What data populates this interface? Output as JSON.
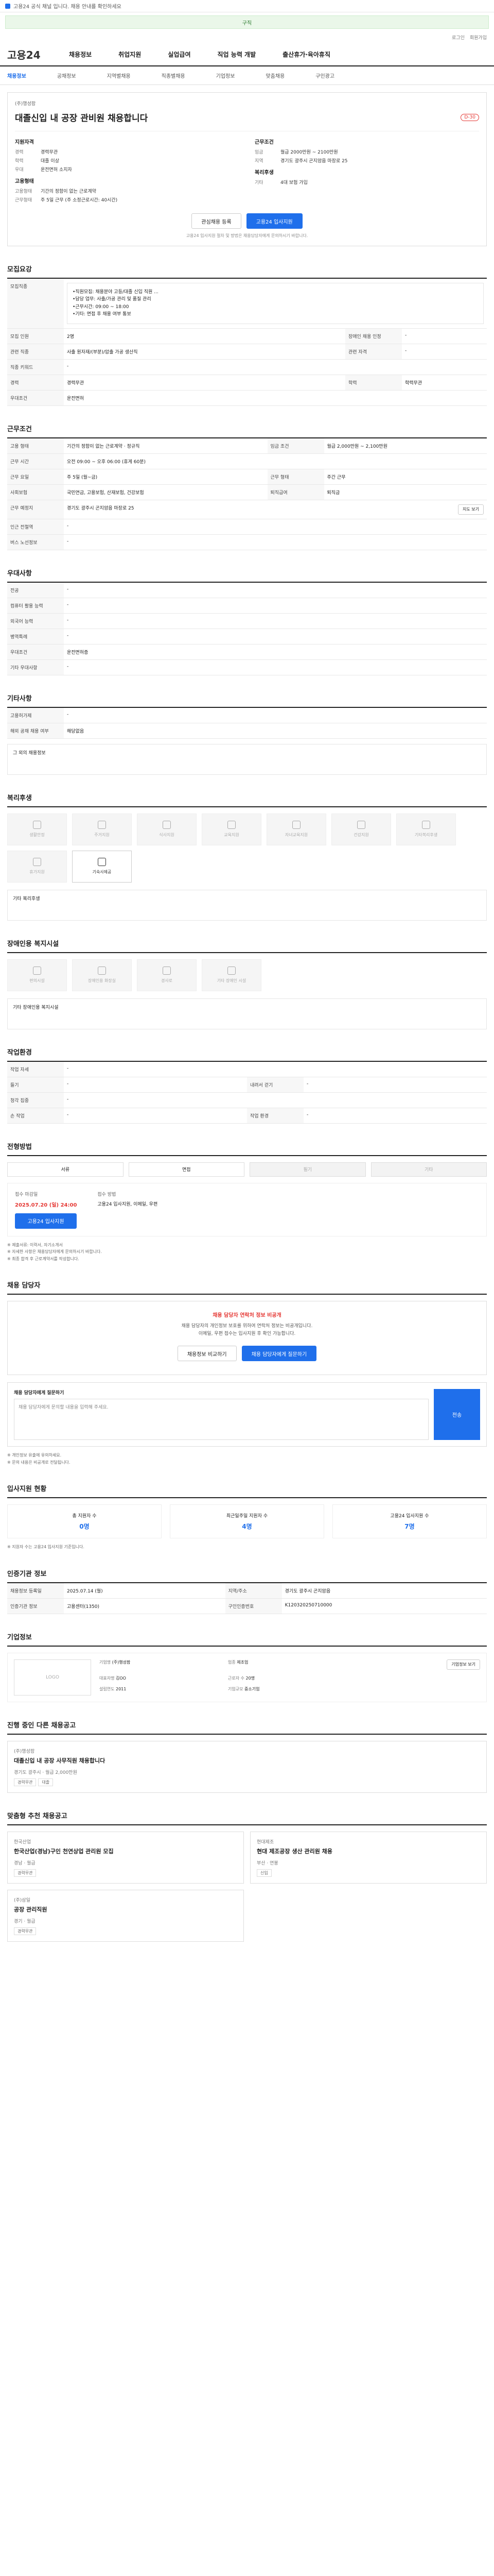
{
  "topbar": {
    "text": "고용24 공식 채널 입니다. 채용 안내를 확인하세요"
  },
  "banner": {
    "text": "구직"
  },
  "util": [
    "로그인",
    "회원가입"
  ],
  "logo": "고용24",
  "gnb": [
    "채용정보",
    "취업지원",
    "실업급여",
    "직업 능력 개발",
    "출산휴가·육아휴직"
  ],
  "subnav": [
    "채용정보",
    "공채정보",
    "지역별채용",
    "직종별채용",
    "기업정보",
    "맞춤채용",
    "구인광고"
  ],
  "summary": {
    "company": "(주)행성팜",
    "title": "대졸신입 내 공장 관비원 채용합니다",
    "dday": "D-30",
    "left_title": "지원자격",
    "left": [
      {
        "k": "경력",
        "v": "경력무관"
      },
      {
        "k": "학력",
        "v": "대졸 이상"
      },
      {
        "k": "우대",
        "v": "운전면허 소지자"
      }
    ],
    "left_title2": "고용형태",
    "left2": [
      {
        "k": "고용형태",
        "v": "기간의 정함이 없는 근로계약"
      },
      {
        "k": "근무형태",
        "v": "주 5일 근무 (주 소정근로시간: 40시간)"
      }
    ],
    "right_title": "근무조건",
    "right": [
      {
        "k": "임금",
        "v": "월급 2000만원 ~ 2100만원"
      },
      {
        "k": "지역",
        "v": "경기도 광주시 곤지암읍 마장로 25"
      }
    ],
    "right_title2": "복리후생",
    "right2": [
      {
        "k": "기타",
        "v": "4대 보험 가입"
      }
    ],
    "btn_save": "관심채용 등록",
    "btn_apply": "고용24 입사지원",
    "note": "고용24 입사지원 절차 및 방법은 채용담당자에게 문의하시기 바랍니다."
  },
  "recruit": {
    "title": "모집요강",
    "content_label": "모집직종",
    "content": "•직원모집: 채용분야 고등/대졸 신입 직원 ...\n•담당 업무: 사출/가공 관리 및 품질 관리\n•근무시간: 09:00 ~ 18:00\n•기타: 면접 후 채용 여부 통보",
    "rows": [
      {
        "h": "모집 인원",
        "v": "2명",
        "h2": "장애인 채용 인정",
        "v2": "-"
      },
      {
        "h": "관련 직종",
        "v": "사출 원자재/(부분)/압출 가공 생산직",
        "h2": "관련 자격",
        "v2": "-"
      },
      {
        "h": "직종 키워드",
        "v": "-",
        "h2": "",
        "v2": ""
      },
      {
        "h": "경력",
        "v": "경력무관",
        "h2": "학력",
        "v2": "학력무관"
      },
      {
        "h": "우대조건",
        "v": "운전면허",
        "h2": "",
        "v2": ""
      }
    ]
  },
  "conditions": {
    "title": "근무조건",
    "rows": [
      {
        "h": "고용 형태",
        "v": "기간의 정함이 없는 근로계약 · 정규직",
        "h2": "임금 조건",
        "v2": "월급 2,000만원 ~ 2,100만원"
      },
      {
        "h": "근무 시간",
        "v": "오전 09:00 ~ 오후 06:00 (휴게 60분)",
        "h2": "",
        "v2": ""
      },
      {
        "h": "근무 요일",
        "v": "주 5일 (월~금)",
        "h2": "근무 형태",
        "v2": "주간 근무"
      },
      {
        "h": "사회보험",
        "v": "국민연금, 고용보험, 산재보험, 건강보험",
        "h2": "퇴직급여",
        "v2": "퇴직금"
      },
      {
        "h": "근무 예정지",
        "v": "경기도 광주시 곤지암읍 마장로 25",
        "h2": "",
        "v2": ""
      },
      {
        "h": "인근 전철역",
        "v": "-",
        "h2": "",
        "v2": ""
      },
      {
        "h": "버스 노선정보",
        "v": "-",
        "h2": "",
        "v2": ""
      }
    ],
    "map_button": "지도 보기"
  },
  "prefer": {
    "title": "우대사항",
    "rows": [
      {
        "h": "전공",
        "v": "-"
      },
      {
        "h": "컴퓨터 활용 능력",
        "v": "-"
      },
      {
        "h": "외국어 능력",
        "v": "-"
      },
      {
        "h": "병역특례",
        "v": "-"
      },
      {
        "h": "우대조건",
        "v": "운전면허증"
      },
      {
        "h": "기타 우대사항",
        "v": "-"
      }
    ]
  },
  "etc": {
    "title": "기타사항",
    "rows": [
      {
        "h": "고용허가제",
        "v": "-"
      },
      {
        "h": "해외 공채 채용 여부",
        "v": "해당없음"
      }
    ],
    "box": "그 외의 채용정보"
  },
  "welfare": {
    "title": "복리후생",
    "tiles": [
      "생활안정",
      "주거지원",
      "식사지원",
      "교육지원",
      "자녀교육지원",
      "건강지원",
      "기타복리후생",
      "휴가지원",
      "기숙사제공"
    ],
    "box": "기타 복리후생"
  },
  "disability": {
    "title": "장애인용 복지시설",
    "tiles": [
      "편의시설",
      "장애인용 화장실",
      "경사로",
      "기타 장애인 시설"
    ],
    "box": "기타 장애인용 복지시설"
  },
  "env": {
    "title": "작업환경",
    "rows": [
      {
        "h": "작업 자세",
        "v": "-",
        "h2": "",
        "v2": ""
      },
      {
        "h": "들기",
        "v": "-",
        "h2": "내려서 걷기",
        "v2": "-"
      },
      {
        "h": "청각 집중",
        "v": "-",
        "h2": "",
        "v2": ""
      },
      {
        "h": "손 작업",
        "v": "-",
        "h2": "작업 환경",
        "v2": "-"
      }
    ]
  },
  "process": {
    "title": "전형방법",
    "steps": [
      "서류",
      "면접",
      "필기",
      "기타"
    ],
    "deadline_label": "접수 마감일",
    "deadline": "2025.07.20 (일) 24:00",
    "method_label": "접수 방법",
    "method": "고용24 입사지원, 이메일, 우편",
    "btn_apply": "고용24 입사지원",
    "bullets": [
      "※ 제출서류: 이력서, 자기소개서",
      "※ 자세한 사항은 채용담당자에게 문의하시기 바랍니다.",
      "※ 최종 합격 후 근로계약서를 작성합니다."
    ]
  },
  "contact": {
    "title": "채용 담당자",
    "alert": "채용 담당자 연락처 정보 비공개",
    "lines": [
      "채용 담당자의 개인정보 보호를 위하여 연락처 정보는 비공개입니다.",
      "이메일, 우편 접수는 입사지원 후 확인 가능합니다."
    ],
    "btn1": "채용정보 비교하기",
    "btn2": "채용 담당자에게 질문하기",
    "q_title": "채용 담당자에게 질문하기",
    "q_placeholder": "채용 담당자에게 문의할 내용을 입력해 주세요.",
    "q_send": "전송",
    "q_notes": [
      "※ 개인정보 유출에 유의하세요.",
      "※ 문의 내용은 비공개로 전달됩니다."
    ]
  },
  "applicants": {
    "title": "입사지원 현황",
    "stats": [
      {
        "label": "총 지원자 수",
        "n": "0명"
      },
      {
        "label": "최근일주일 지원자 수",
        "n": "4명"
      },
      {
        "label": "고용24 입사지원 수",
        "n": "7명"
      }
    ],
    "note": "※ 지원자 수는 고용24 입사지원 기준입니다."
  },
  "basic": {
    "title": "인증기관 정보",
    "rows": [
      {
        "h": "채용정보 등록일",
        "v": "2025.07.14 (월)",
        "h2": "지역/주소",
        "v2": "경기도 광주시 곤지암읍"
      },
      {
        "h": "인증기관 정보",
        "v": "고용센터(1350)",
        "h2": "구인인증번호",
        "v2": "K120320250710000"
      }
    ]
  },
  "company": {
    "title": "기업정보",
    "logo": "LOGO",
    "rows": [
      {
        "k": "기업명",
        "v": "(주)행성팜"
      },
      {
        "k": "업종",
        "v": "제조업"
      },
      {
        "k": "대표자명",
        "v": "김OO"
      },
      {
        "k": "근로자 수",
        "v": "20명"
      },
      {
        "k": "설립연도",
        "v": "2011"
      },
      {
        "k": "기업규모",
        "v": "중소기업"
      }
    ],
    "btn": "기업정보 보기"
  },
  "similar": {
    "title": "진행 중인 다른 채용공고",
    "cards": [
      {
        "company": "(주)행성팜",
        "title": "대졸신입 내 공장 사무직원 채용합니다",
        "meta": "경기도 광주시 · 월급 2,000만원",
        "tags": [
          "경력무관",
          "대졸"
        ]
      }
    ]
  },
  "recommend": {
    "title": "맞춤형 추천 채용공고",
    "cards": [
      {
        "company": "한국산업",
        "title": "한국산업(경남)구인 천연상업 관리원 모집",
        "meta": "경남 · 월급",
        "tags": [
          "경력무관"
        ]
      },
      {
        "company": "현대제조",
        "title": "현대 제조공장 생산 관리원 채용",
        "meta": "부산 · 연봉",
        "tags": [
          "신입"
        ]
      },
      {
        "company": "(주)삼일",
        "title": "공장 관리직원",
        "meta": "경기 · 월급",
        "tags": [
          "경력무관"
        ]
      }
    ]
  }
}
